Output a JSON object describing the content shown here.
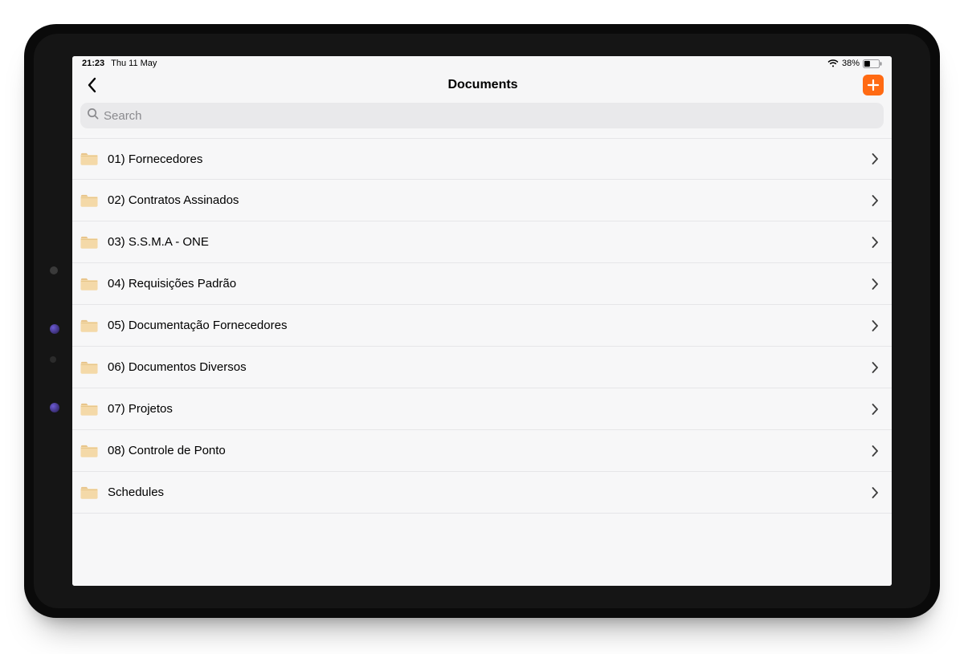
{
  "status_bar": {
    "time": "21:23",
    "date": "Thu 11 May",
    "battery_percent": "38%"
  },
  "header": {
    "title": "Documents"
  },
  "search": {
    "placeholder": "Search",
    "value": ""
  },
  "folders": [
    {
      "label": "01) Fornecedores"
    },
    {
      "label": "02) Contratos Assinados"
    },
    {
      "label": "03) S.S.M.A - ONE"
    },
    {
      "label": "04) Requisições Padrão"
    },
    {
      "label": "05) Documentação Fornecedores"
    },
    {
      "label": "06) Documentos Diversos"
    },
    {
      "label": "07) Projetos"
    },
    {
      "label": "08) Controle de Ponto"
    },
    {
      "label": "Schedules"
    }
  ],
  "colors": {
    "accent": "#ff6a13"
  }
}
